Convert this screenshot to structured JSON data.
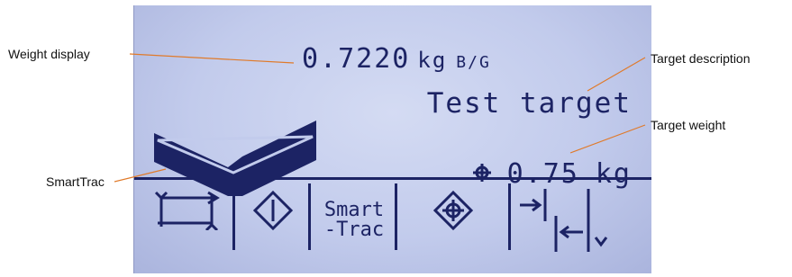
{
  "display": {
    "weight_value": "0.7220",
    "weight_unit": "kg",
    "weight_mode": "B/G",
    "target_description": "Test target",
    "target_value": "0.75",
    "target_unit": "kg",
    "smarttrac_indicator": "chevron-down"
  },
  "softkeys": [
    {
      "icon": "swap-arrows-icon"
    },
    {
      "icon": "diamond-info-icon"
    },
    {
      "line1": "Smart",
      "line2": "-Trac"
    },
    {
      "icon": "target-diamond-icon"
    },
    {
      "icon": "arrow-left-right-icon"
    },
    {
      "icon": "chevron-down-icon"
    }
  ],
  "callouts": {
    "weight_display": "Weight display",
    "smarttrac": "SmartTrac",
    "target_description": "Target description",
    "target_weight": "Target weight"
  },
  "colors": {
    "lcd_background": "#c2cbec",
    "lcd_foreground": "#1c2364",
    "leader_line": "#e07a2a"
  }
}
